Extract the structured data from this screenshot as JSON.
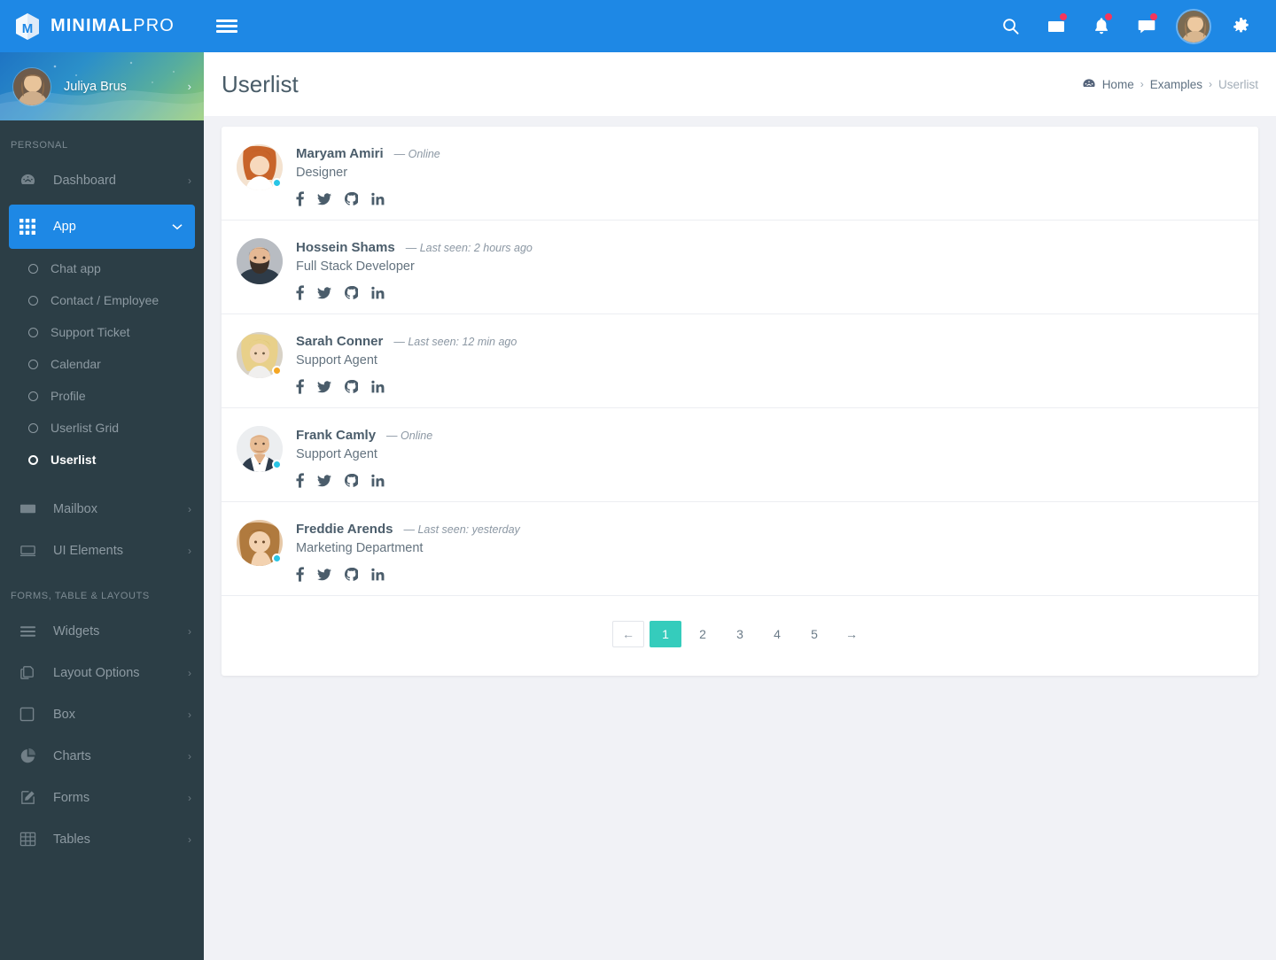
{
  "brand": {
    "name_bold": "MINIMAL",
    "name_light": "PRO",
    "logo_icon": "hexagon-m-logo-icon"
  },
  "profile": {
    "name": "Juliya Brus",
    "chevron": "›",
    "avatar_icon": "user-avatar"
  },
  "topbar": {
    "menu_toggle_icon": "hamburger-icon",
    "icons": [
      {
        "name": "search-icon",
        "badge": false
      },
      {
        "name": "envelope-icon",
        "badge": true
      },
      {
        "name": "bell-icon",
        "badge": true
      },
      {
        "name": "chat-bubble-icon",
        "badge": true
      }
    ],
    "avatar_icon": "topbar-avatar",
    "settings_icon": "gear-icon"
  },
  "sidebar": {
    "sections": [
      {
        "title": "PERSONAL",
        "items": [
          {
            "label": "Dashboard",
            "icon": "dashboard-gauge-icon",
            "arrow": "›",
            "active": false
          },
          {
            "label": "App",
            "icon": "grid-apps-icon",
            "arrow": "⌄",
            "active": true,
            "children": [
              {
                "label": "Chat app",
                "current": false
              },
              {
                "label": "Contact / Employee",
                "current": false
              },
              {
                "label": "Support Ticket",
                "current": false
              },
              {
                "label": "Calendar",
                "current": false
              },
              {
                "label": "Profile",
                "current": false
              },
              {
                "label": "Userlist Grid",
                "current": false
              },
              {
                "label": "Userlist",
                "current": true
              }
            ]
          },
          {
            "label": "Mailbox",
            "icon": "envelope-icon",
            "arrow": "›",
            "active": false
          },
          {
            "label": "UI Elements",
            "icon": "window-icon",
            "arrow": "›",
            "active": false
          }
        ]
      },
      {
        "title": "FORMS, TABLE & LAYOUTS",
        "items": [
          {
            "label": "Widgets",
            "icon": "list-lines-icon",
            "arrow": "›",
            "active": false
          },
          {
            "label": "Layout Options",
            "icon": "copy-pages-icon",
            "arrow": "›",
            "active": false
          },
          {
            "label": "Box",
            "icon": "square-icon",
            "arrow": "›",
            "active": false
          },
          {
            "label": "Charts",
            "icon": "pie-chart-icon",
            "arrow": "›",
            "active": false
          },
          {
            "label": "Forms",
            "icon": "pencil-square-icon",
            "arrow": "›",
            "active": false
          },
          {
            "label": "Tables",
            "icon": "table-grid-icon",
            "arrow": "›",
            "active": false
          }
        ]
      }
    ]
  },
  "page": {
    "title": "Userlist",
    "breadcrumb": {
      "home_icon": "home-dome-icon",
      "items": [
        {
          "label": "Home",
          "muted": false
        },
        {
          "label": "Examples",
          "muted": false
        },
        {
          "label": "Userlist",
          "muted": true
        }
      ],
      "separator": "›"
    }
  },
  "users": [
    {
      "name": "Maryam Amiri",
      "seen": "— Online",
      "role": "Designer",
      "status_color": "#29c5e6",
      "avatar": "female-redhead"
    },
    {
      "name": "Hossein Shams",
      "seen": "— Last seen: 2 hours ago",
      "role": "Full Stack Developer",
      "status_color": "",
      "avatar": "male-beard"
    },
    {
      "name": "Sarah Conner",
      "seen": "— Last seen: 12 min ago",
      "role": "Support Agent",
      "status_color": "#f5a623",
      "avatar": "female-blonde"
    },
    {
      "name": "Frank Camly",
      "seen": "— Online",
      "role": "Support Agent",
      "status_color": "#29c5e6",
      "avatar": "male-bald"
    },
    {
      "name": "Freddie Arends",
      "seen": "— Last seen: yesterday",
      "role": "Marketing Department",
      "status_color": "#29c5e6",
      "avatar": "female-brunette"
    }
  ],
  "social_links": [
    {
      "name": "facebook-icon",
      "label": "f"
    },
    {
      "name": "twitter-icon",
      "label": "t"
    },
    {
      "name": "github-icon",
      "label": "g"
    },
    {
      "name": "linkedin-icon",
      "label": "in"
    }
  ],
  "pagination": {
    "prev": "←",
    "next": "→",
    "pages": [
      "1",
      "2",
      "3",
      "4",
      "5"
    ],
    "active_page": "1",
    "active_color": "#35ccbc"
  },
  "colors": {
    "primary": "#1e88e5",
    "sidebar_bg": "#2c3e46",
    "content_bg": "#f1f2f6",
    "accent_teal": "#35ccbc",
    "badge_red": "#f5365c"
  }
}
